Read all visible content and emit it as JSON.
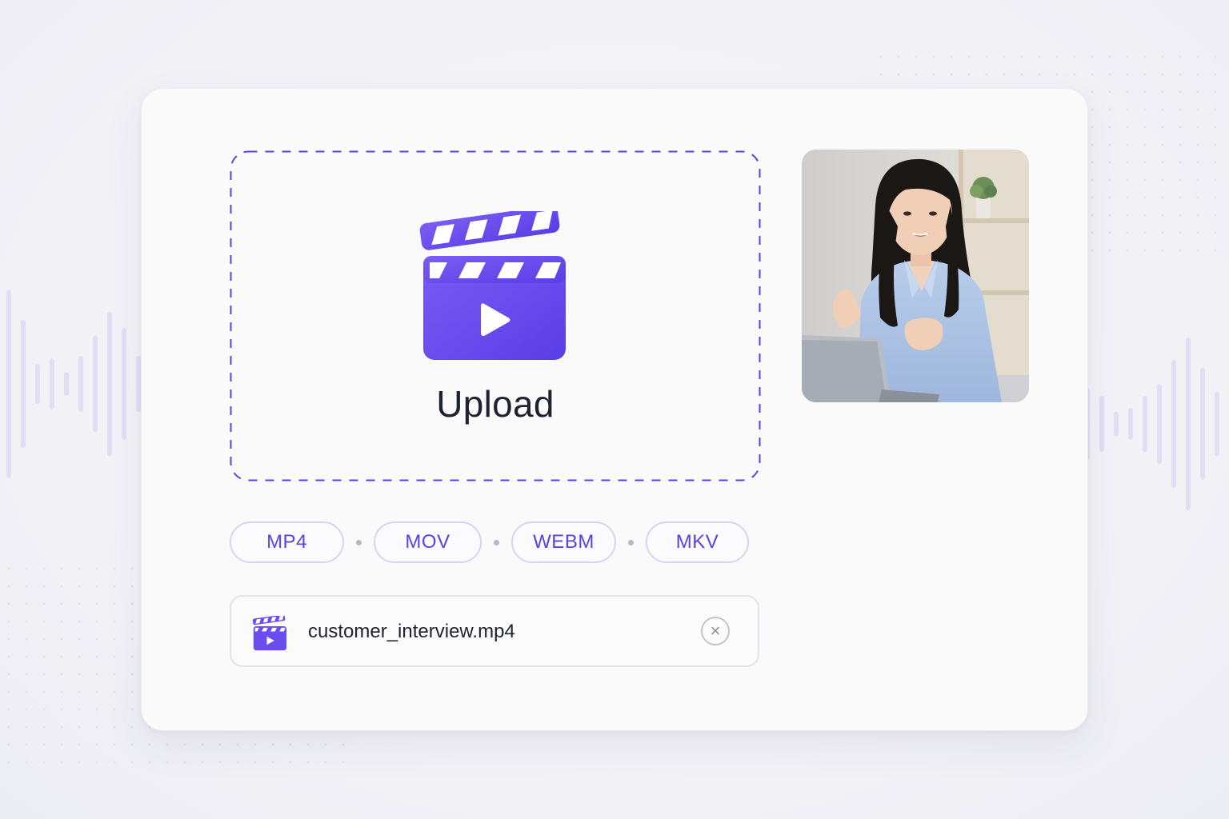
{
  "colors": {
    "accent": "#5b40e6",
    "accent_light": "#7b5cf5",
    "chip_border": "#d8d2f3",
    "text_dark": "#1f2230"
  },
  "dropzone": {
    "icon": "clapperboard-play-icon",
    "label": "Upload"
  },
  "preview": {
    "icon": "person-photo"
  },
  "formats": [
    {
      "label": "MP4"
    },
    {
      "label": "MOV"
    },
    {
      "label": "WEBM"
    },
    {
      "label": "MKV"
    }
  ],
  "file": {
    "icon": "clapperboard-play-icon",
    "name": "customer_interview.mp4",
    "remove_icon": "close-circle-icon",
    "remove_glyph": "×"
  }
}
